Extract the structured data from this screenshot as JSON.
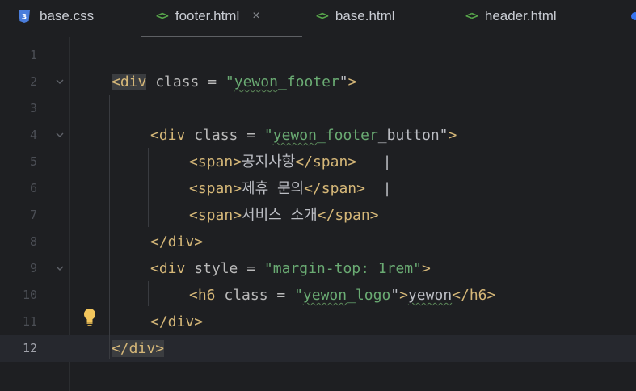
{
  "tabs": [
    {
      "label": "base.css",
      "icon": "css-file-icon",
      "active": false
    },
    {
      "label": "footer.html",
      "icon": "html-file-icon",
      "active": true
    },
    {
      "label": "base.html",
      "icon": "html-file-icon",
      "active": false
    },
    {
      "label": "header.html",
      "icon": "html-file-icon",
      "active": false
    }
  ],
  "html_icon_glyph": "<>",
  "close_glyph": "×",
  "current_line": 12,
  "lines": [
    {
      "n": "1",
      "code": ""
    },
    {
      "n": "2",
      "code": "<div class = \"yewon_footer\">"
    },
    {
      "n": "3",
      "code": ""
    },
    {
      "n": "4",
      "code": "<div class = \"yewon_footer_button\">"
    },
    {
      "n": "5",
      "code": "<span>공지사항</span>   |"
    },
    {
      "n": "6",
      "code": "<span>제휴 문의</span>  |"
    },
    {
      "n": "7",
      "code": "<span>서비스 소개</span>"
    },
    {
      "n": "8",
      "code": "</div>"
    },
    {
      "n": "9",
      "code": "<div style = \"margin-top: 1rem\">"
    },
    {
      "n": "10",
      "code": "<h6 class = \"yewon_logo\">yewon</h6>"
    },
    {
      "n": "11",
      "code": "</div>"
    },
    {
      "n": "12",
      "code": "</div>"
    }
  ],
  "colors": {
    "tag": "#d5b778",
    "attribute": "#bababa",
    "string": "#6aab73",
    "background": "#1e1f22"
  }
}
